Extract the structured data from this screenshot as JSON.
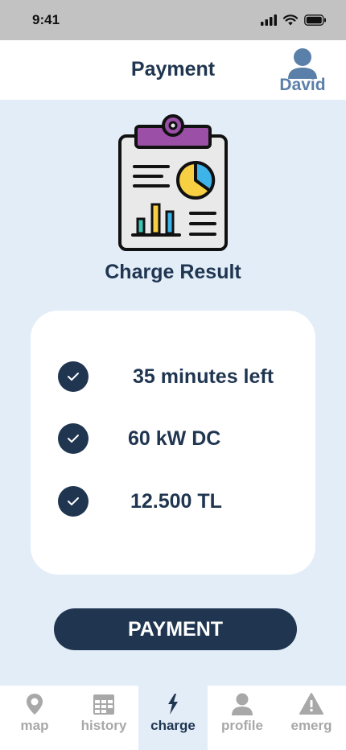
{
  "status_bar": {
    "time": "9:41"
  },
  "header": {
    "title": "Payment",
    "user_name": "David"
  },
  "result": {
    "title": "Charge Result",
    "items": [
      {
        "text": "35 minutes left"
      },
      {
        "text": "60 kW DC"
      },
      {
        "text": "12.500 TL"
      }
    ]
  },
  "payment_button": {
    "label": "PAYMENT"
  },
  "tabbar": {
    "active": "charge",
    "tabs": [
      {
        "label": "map",
        "icon": "map-pin-icon"
      },
      {
        "label": "history",
        "icon": "calendar-icon"
      },
      {
        "label": "charge",
        "icon": "lightning-icon"
      },
      {
        "label": "profile",
        "icon": "user-icon"
      },
      {
        "label": "emerg",
        "icon": "warning-icon"
      }
    ]
  },
  "colors": {
    "primary": "#1f3550",
    "background": "#e3edf8",
    "user_accent": "#5a7fa8",
    "inactive_tab": "#a8a8a8",
    "status_bar": "#c2c2c2"
  }
}
